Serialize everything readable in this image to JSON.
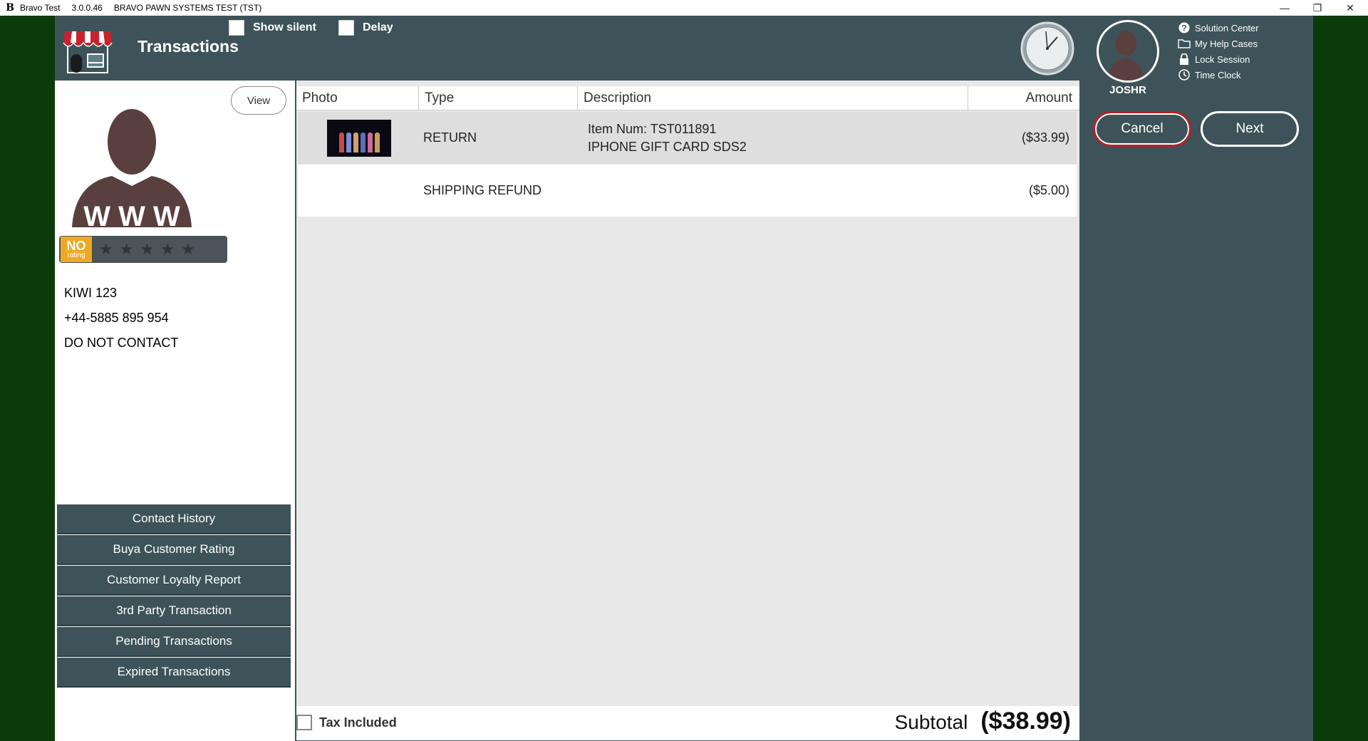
{
  "titlebar": {
    "app_name": "Bravo Test",
    "version": "3.0.0.46",
    "system": "BRAVO PAWN SYSTEMS TEST (TST)"
  },
  "header": {
    "title": "Transactions",
    "show_silent_label": "Show silent",
    "delay_label": "Delay",
    "user_name": "JOSHR"
  },
  "help_links": {
    "solution_center": "Solution Center",
    "my_help_cases": "My Help Cases",
    "lock_session": "Lock Session",
    "time_clock": "Time Clock"
  },
  "actions": {
    "cancel": "Cancel",
    "next": "Next"
  },
  "customer": {
    "view_label": "View",
    "rating_no": "NO",
    "rating_sub": "rating",
    "address": "KIWI 123",
    "phone": "+44-5885 895 954",
    "contact_note": "DO NOT CONTACT"
  },
  "side_menu": {
    "contact_history": "Contact History",
    "buya_rating": "Buya Customer Rating",
    "loyalty_report": "Customer Loyalty Report",
    "third_party": "3rd Party Transaction",
    "pending": "Pending Transactions",
    "expired": "Expired Transactions"
  },
  "table": {
    "columns": {
      "photo": "Photo",
      "type": "Type",
      "description": "Description",
      "amount": "Amount"
    },
    "rows": [
      {
        "type": "RETURN",
        "desc_line1": "Item Num: TST011891",
        "desc_line2": "IPHONE GIFT CARD SDS2",
        "amount": "($33.99)"
      },
      {
        "type": "SHIPPING REFUND",
        "desc_line1": "",
        "desc_line2": "",
        "amount": "($5.00)"
      }
    ]
  },
  "footer": {
    "tax_included": "Tax Included",
    "subtotal_label": "Subtotal",
    "subtotal_value": "($38.99)"
  },
  "colors": {
    "header_bg": "#3d5359",
    "side_green": "#0b3b0b",
    "cancel_border": "#b0242a",
    "rating_badge": "#f0a823"
  }
}
